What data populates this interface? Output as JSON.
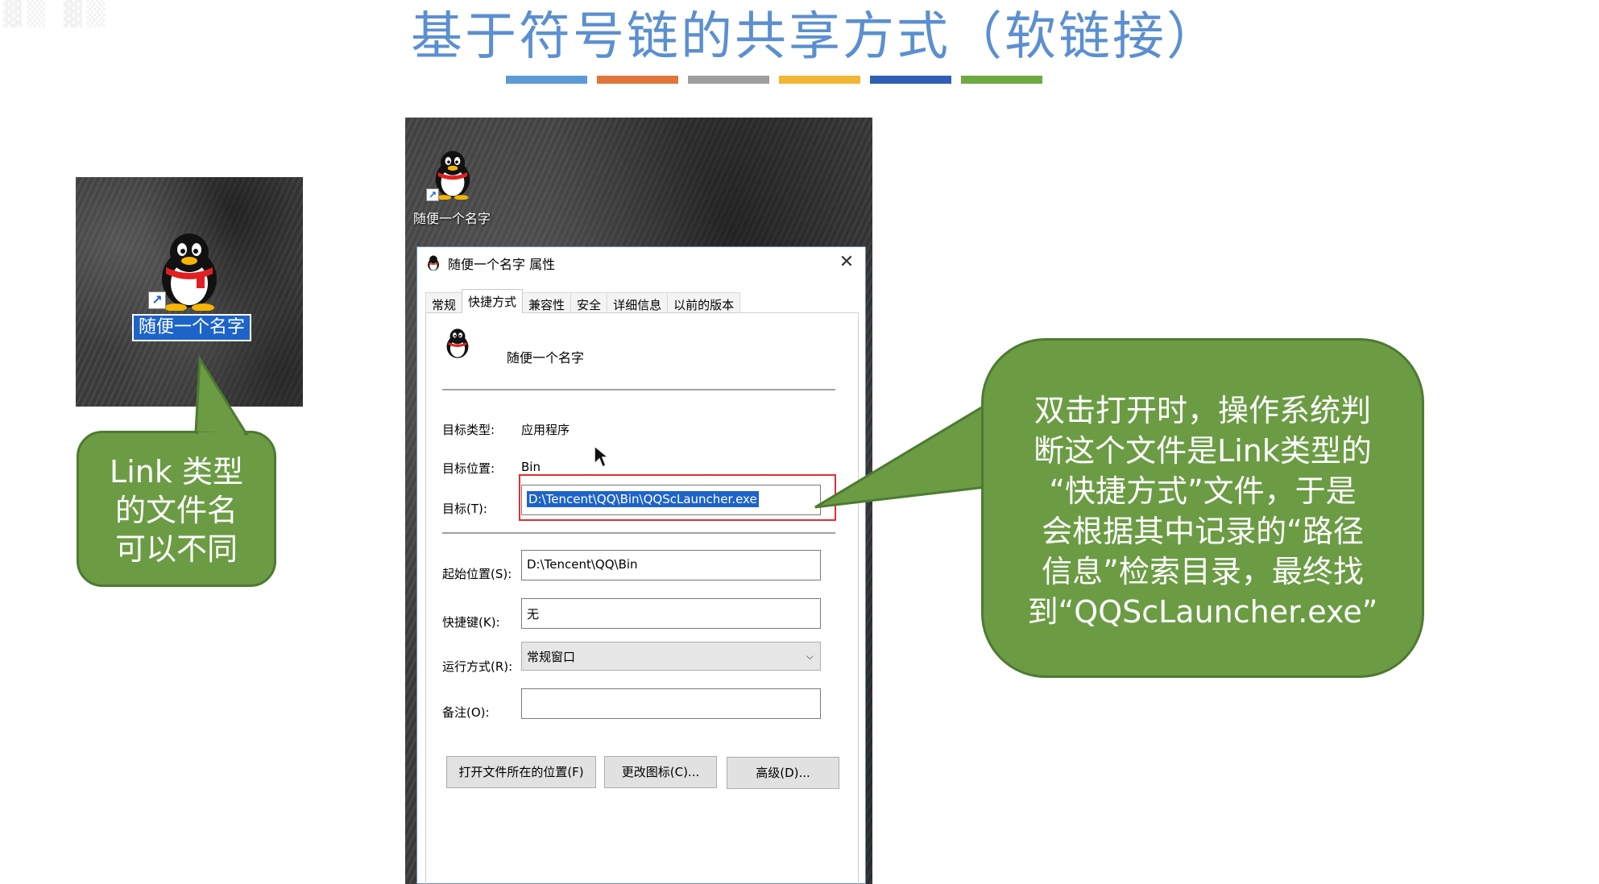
{
  "slide": {
    "title": "基于符号链的共享方式（软链接）",
    "bar_colors": [
      "#5b9bd5",
      "#e0763a",
      "#9e9e9e",
      "#f2b632",
      "#2f5fb4",
      "#70a844"
    ]
  },
  "left_icon": {
    "label": "随便一个名字",
    "icon": "qq-penguin-icon"
  },
  "left_note": {
    "lines": [
      "Link 类型",
      "的文件名",
      "可以不同"
    ]
  },
  "desktop": {
    "icon_label": "随便一个名字"
  },
  "dialog": {
    "title": "随便一个名字 属性",
    "close": "✕",
    "tabs": [
      "常规",
      "快捷方式",
      "兼容性",
      "安全",
      "详细信息",
      "以前的版本"
    ],
    "active_tab": "快捷方式",
    "shortcut_name": "随便一个名字",
    "target_type_label": "目标类型:",
    "target_type_value": "应用程序",
    "target_location_label": "目标位置:",
    "target_location_value": "Bin",
    "target_label": "目标(T):",
    "target_value": "D:\\Tencent\\QQ\\Bin\\QQScLauncher.exe",
    "start_in_label": "起始位置(S):",
    "start_in_value": "D:\\Tencent\\QQ\\Bin",
    "shortcut_key_label": "快捷键(K):",
    "shortcut_key_value": "无",
    "run_label": "运行方式(R):",
    "run_value": "常规窗口",
    "comment_label": "备注(O):",
    "comment_value": "",
    "buttons": {
      "open_location": "打开文件所在的位置(F)",
      "change_icon": "更改图标(C)...",
      "advanced": "高级(D)..."
    }
  },
  "right_note": {
    "lines": [
      "双击打开时，操作系统判",
      "断这个文件是Link类型的",
      "“快捷方式”文件，于是",
      "会根据其中记录的“路径",
      "信息”检索目录，最终找",
      "到“QQScLauncher.exe”"
    ]
  },
  "colors": {
    "title": "#5b8fd0",
    "note_fill": "#6b9c44",
    "note_border": "#4e7a32",
    "selection": "#1e64c8",
    "highlight": "#e03030"
  }
}
